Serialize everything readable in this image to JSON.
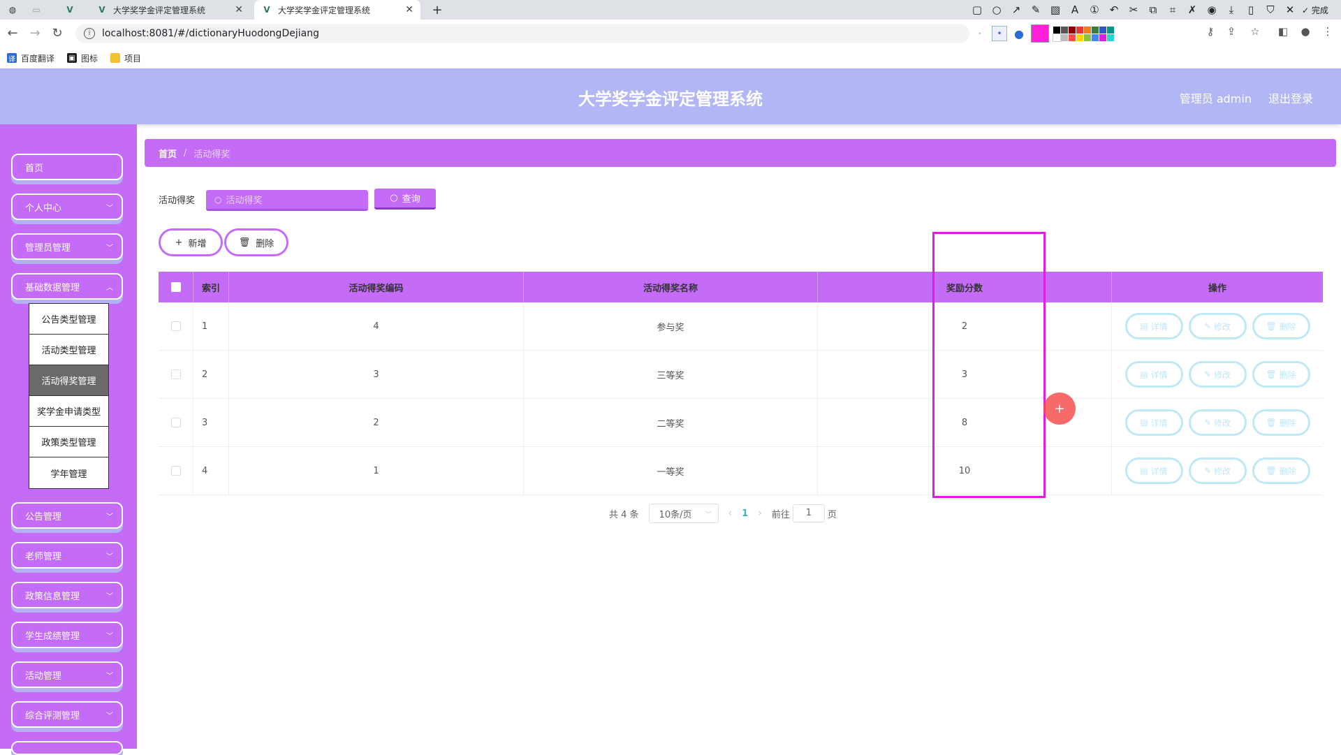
{
  "browser": {
    "tabs": [
      {
        "title": "大学奖学金评定管理系统",
        "active": false
      },
      {
        "title": "大学奖学金评定管理系统",
        "active": true
      }
    ],
    "new_tab": "+",
    "url": "localhost:8081/#/dictionaryHuodongDejiang",
    "done_label": "完成",
    "bookmarks": [
      {
        "label": "百度翻译",
        "icon": "translate-icon"
      },
      {
        "label": "图标",
        "icon": "icon-bookmark-icon"
      },
      {
        "label": "项目",
        "icon": "folder-icon"
      }
    ],
    "palette_color": "#ff1fd6"
  },
  "header": {
    "title": "大学奖学金评定管理系统",
    "user": "管理员 admin",
    "logout": "退出登录",
    "bg_color": "#b3b6f4"
  },
  "sidebar": {
    "menus": [
      {
        "label": "首页",
        "has_chevron": false
      },
      {
        "label": "个人中心",
        "has_chevron": true
      },
      {
        "label": "管理员管理",
        "has_chevron": true
      },
      {
        "label": "基础数据管理",
        "has_chevron": true
      },
      {
        "label": "公告管理",
        "has_chevron": true
      },
      {
        "label": "老师管理",
        "has_chevron": true
      },
      {
        "label": "政策信息管理",
        "has_chevron": true
      },
      {
        "label": "学生成绩管理",
        "has_chevron": true
      },
      {
        "label": "活动管理",
        "has_chevron": true
      },
      {
        "label": "综合评测管理",
        "has_chevron": true
      }
    ],
    "submenu": [
      {
        "label": "公告类型管理",
        "active": false
      },
      {
        "label": "活动类型管理",
        "active": false
      },
      {
        "label": "活动得奖管理",
        "active": true
      },
      {
        "label": "奖学金申请类型",
        "active": false
      },
      {
        "label": "政策类型管理",
        "active": false
      },
      {
        "label": "学年管理",
        "active": false
      }
    ],
    "bg_color": "#c46cf7"
  },
  "breadcrumb": {
    "home": "首页",
    "separator": "/",
    "current": "活动得奖"
  },
  "search": {
    "label": "活动得奖",
    "placeholder": "活动得奖",
    "button": "查询"
  },
  "actions": {
    "add": "新增",
    "delete": "删除"
  },
  "table": {
    "headers": {
      "index": "索引",
      "code": "活动得奖编码",
      "name": "活动得奖名称",
      "score": "奖励分数",
      "ops": "操作"
    },
    "rows": [
      {
        "index": "1",
        "code": "4",
        "name": "参与奖",
        "score": "2"
      },
      {
        "index": "2",
        "code": "3",
        "name": "三等奖",
        "score": "3"
      },
      {
        "index": "3",
        "code": "2",
        "name": "二等奖",
        "score": "8"
      },
      {
        "index": "4",
        "code": "1",
        "name": "一等奖",
        "score": "10"
      }
    ],
    "row_ops": {
      "detail": "详情",
      "edit": "修改",
      "delete": "删除"
    }
  },
  "pagination": {
    "total": "共 4 条",
    "page_size": "10条/页",
    "current_page": "1",
    "goto_label": "前往",
    "goto_value": "1",
    "page_suffix": "页"
  }
}
